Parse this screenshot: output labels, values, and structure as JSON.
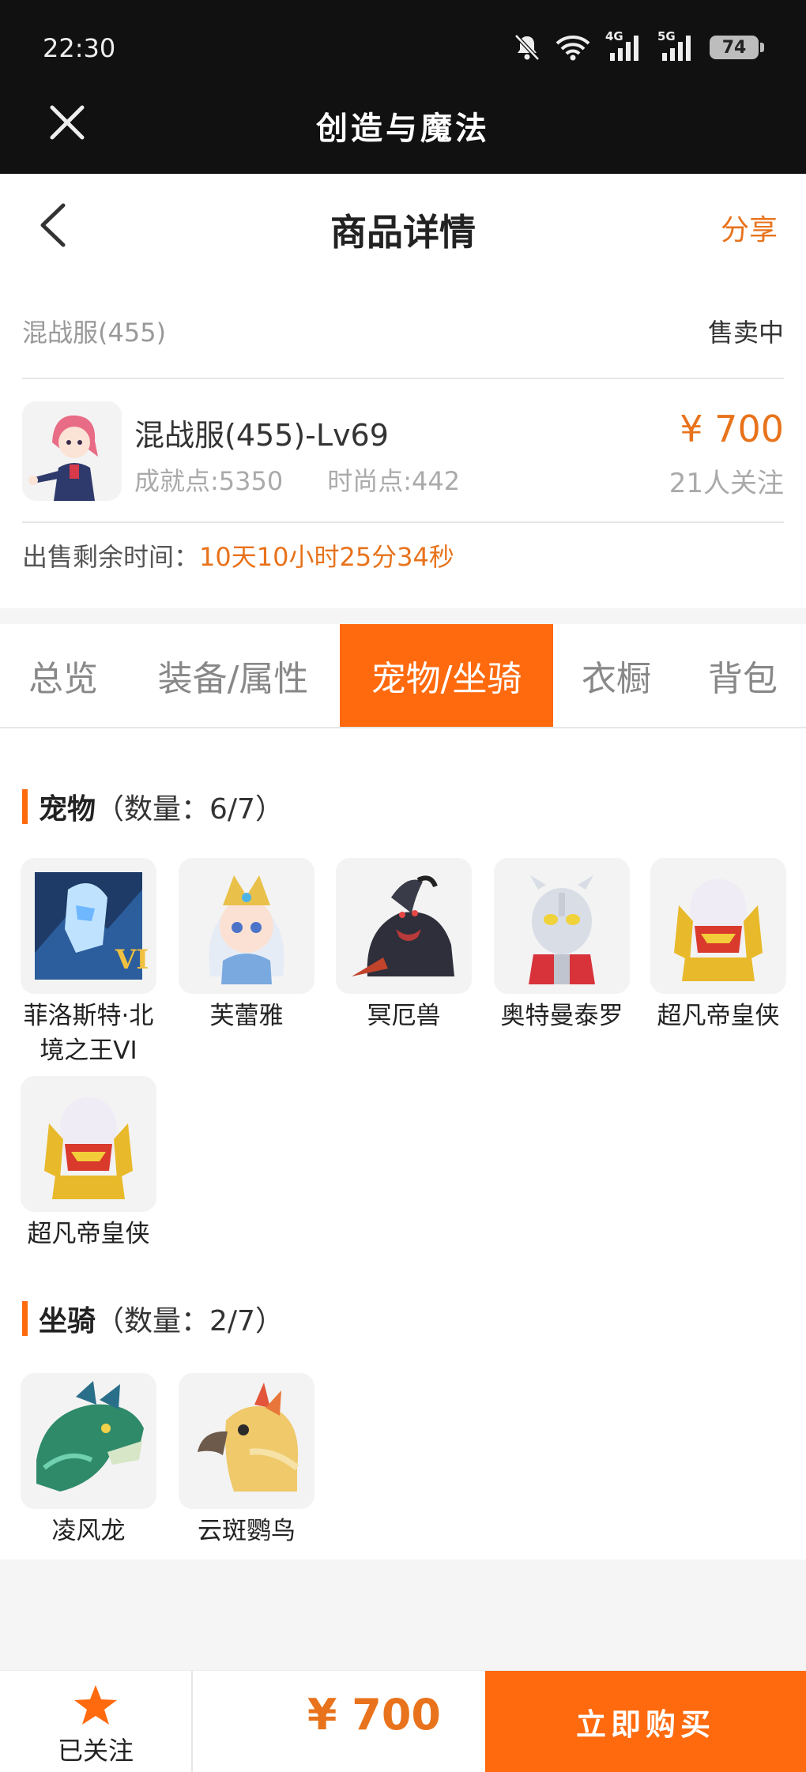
{
  "statusbar": {
    "time": "22:30",
    "battery": "74",
    "net1": "4G",
    "net2": "5G"
  },
  "appbar": {
    "title": "创造与魔法"
  },
  "header": {
    "title": "商品详情",
    "share": "分享"
  },
  "info": {
    "server": "混战服(455)",
    "status": "售卖中",
    "product_name": "混战服(455)-Lv69",
    "achievement": "成就点:5350",
    "fashion": "时尚点:442",
    "price": "¥ 700",
    "follow_count": "21人关注",
    "remaining_label": "出售剩余时间：",
    "remaining_time": "10天10小时25分34秒"
  },
  "tabs": [
    {
      "label": "总览"
    },
    {
      "label": "装备/属性"
    },
    {
      "label": "宠物/坐骑",
      "active": true
    },
    {
      "label": "衣橱"
    },
    {
      "label": "背包"
    }
  ],
  "pets": {
    "title": "宠物",
    "count": "（数量：6/7）",
    "items": [
      {
        "name": "菲洛斯特·北境之王VI"
      },
      {
        "name": "芙蕾雅"
      },
      {
        "name": "冥厄兽"
      },
      {
        "name": "奥特曼泰罗"
      },
      {
        "name": "超凡帝皇侠"
      },
      {
        "name": "超凡帝皇侠"
      }
    ]
  },
  "mounts": {
    "title": "坐骑",
    "count": "（数量：2/7）",
    "items": [
      {
        "name": "凌风龙"
      },
      {
        "name": "云斑鹦鸟"
      }
    ]
  },
  "bottom": {
    "followed": "已关注",
    "price": "¥ 700",
    "buy": "立即购买"
  },
  "colors": {
    "accent": "#ff6a0e",
    "price": "#e8731c",
    "dark_bar": "#111111"
  }
}
